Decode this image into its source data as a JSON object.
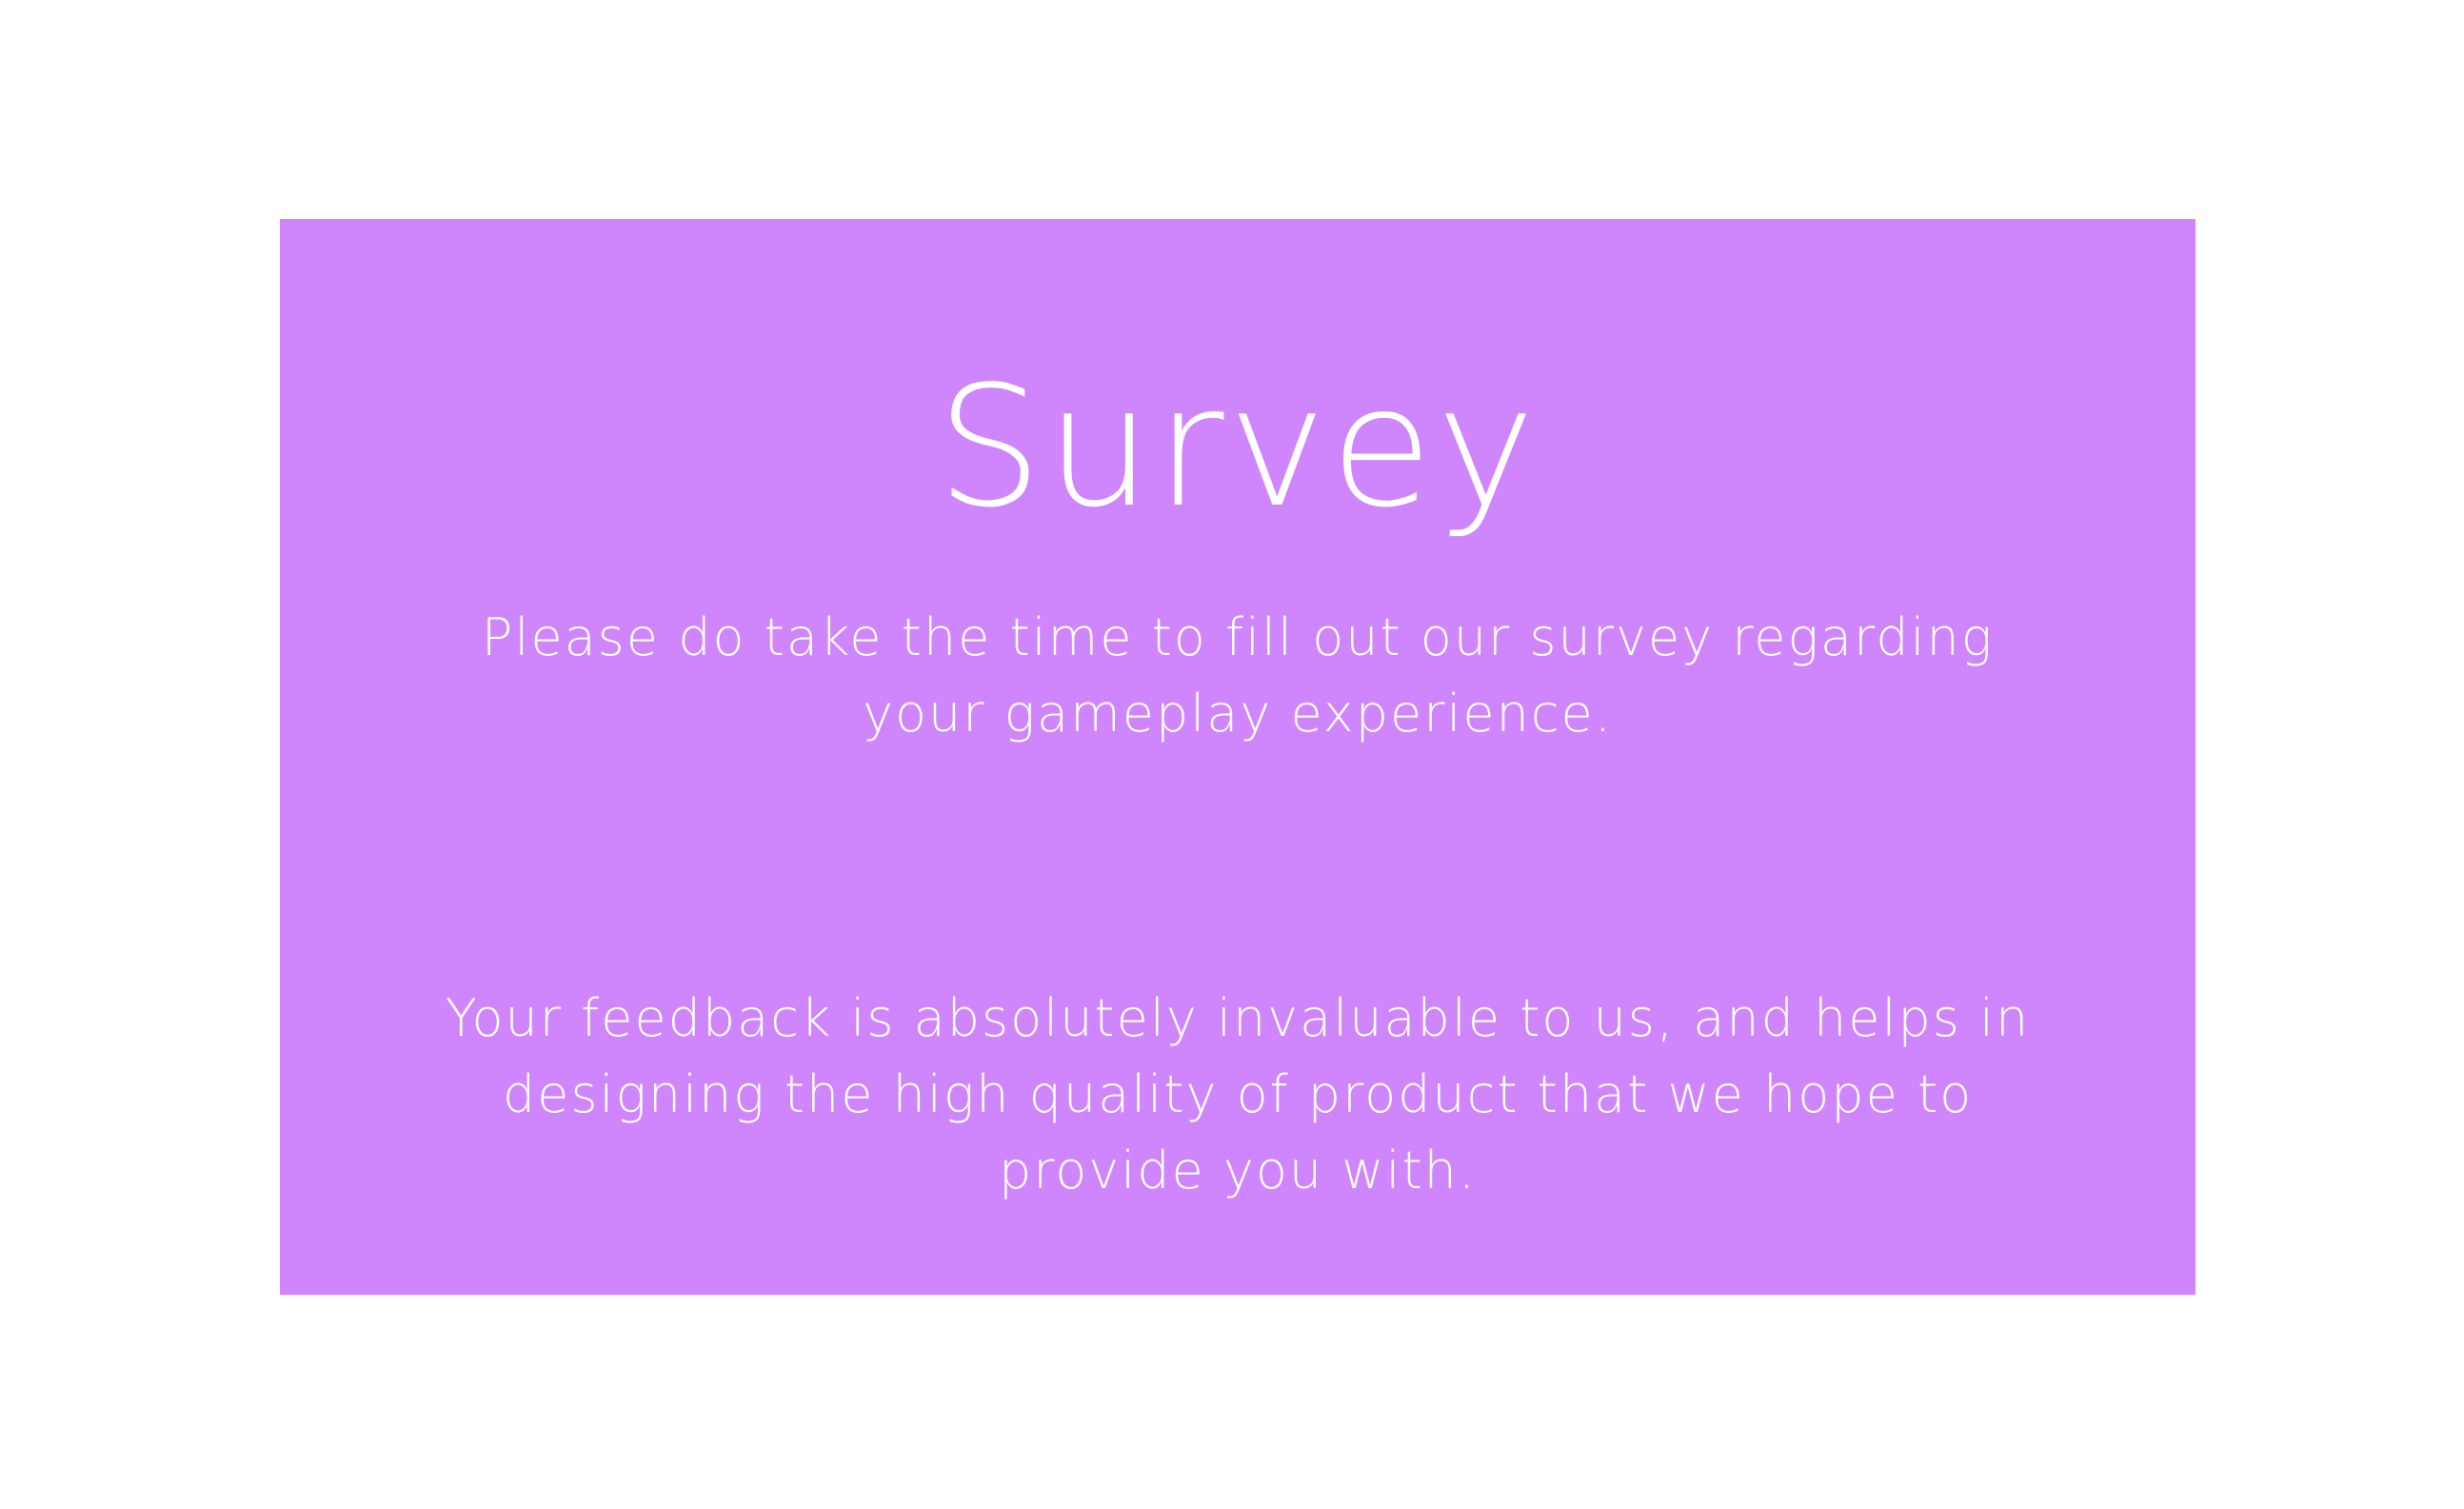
{
  "panel": {
    "background_color": "#cf86fd",
    "text_color": "#ffffff"
  },
  "survey": {
    "title": "Survey",
    "intro": "Please do take the time to fill out our survey regarding your gameplay experience.",
    "feedback": "Your feedback is absolutely invaluable to us, and helps in designing the high quality of product that we hope to provide you with."
  }
}
